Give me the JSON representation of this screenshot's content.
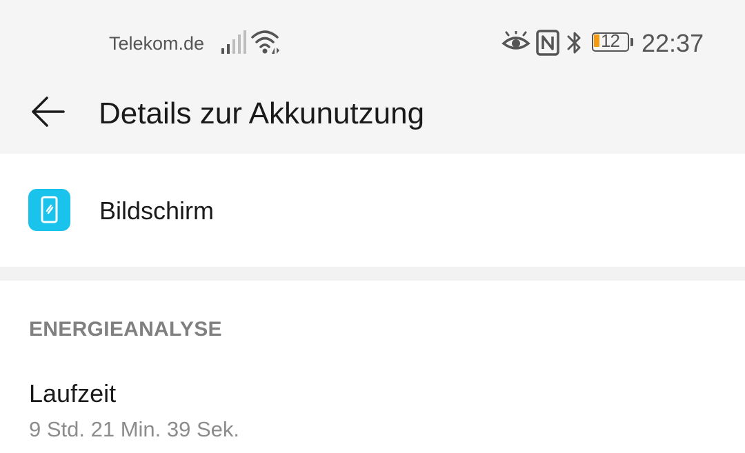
{
  "status_bar": {
    "carrier": "Telekom.de",
    "battery_level": "12",
    "battery_fraction": 0.12,
    "battery_fill_color": "#f39c12",
    "time": "22:37",
    "icons": [
      "signal-icon",
      "wifi-icon",
      "eye-comfort-icon",
      "nfc-icon",
      "bluetooth-icon",
      "battery-icon"
    ]
  },
  "header": {
    "title": "Details zur Akkunutzung",
    "back_icon": "arrow-left-icon"
  },
  "app": {
    "name": "Bildschirm",
    "icon": "screen-icon",
    "icon_color": "#19c3ec"
  },
  "energy_analysis": {
    "header": "ENERGIEANALYSE",
    "runtime_label": "Laufzeit",
    "runtime_value": "9 Std. 21 Min. 39 Sek."
  }
}
